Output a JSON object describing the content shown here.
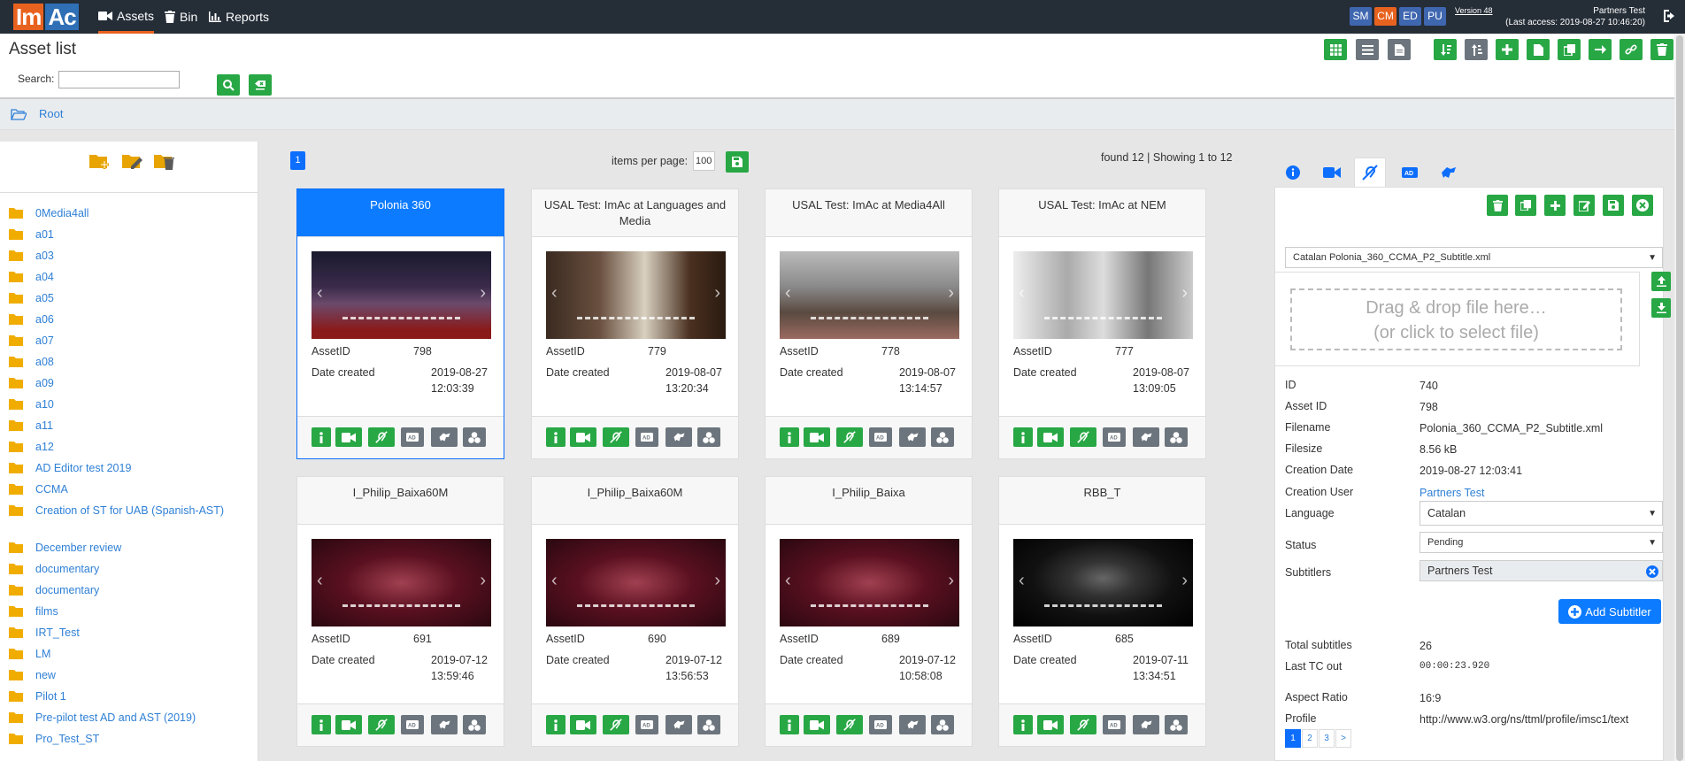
{
  "nav": {
    "logo_a": "Im",
    "logo_b": "Ac",
    "links": [
      "Assets",
      "Bin",
      "Reports"
    ],
    "roles": [
      "SM",
      "CM",
      "ED",
      "PU"
    ],
    "version": "Version 48",
    "user_name": "Partners Test",
    "last_access": "(Last access: 2019-08-27 10:46:20)",
    "accent": "#e8621f",
    "brand_blue": "#2f6fb5"
  },
  "header": {
    "title": "Asset list",
    "search_label": "Search:",
    "search_value": "",
    "toolbar_icons": [
      "grid-icon",
      "list-icon",
      "document-icon",
      "sort-down-icon",
      "sort-up-icon",
      "plus-icon",
      "file-icon",
      "copy-icon",
      "arrow-right-icon",
      "link-icon",
      "trash-icon"
    ]
  },
  "breadcrumb": {
    "root": "Root"
  },
  "sidebar": {
    "folders": [
      "0Media4all",
      "a01",
      "a03",
      "a04",
      "a05",
      "a06",
      "a07",
      "a08",
      "a09",
      "a10",
      "a11",
      "a12",
      "AD Editor test 2019",
      "CCMA",
      "Creation of ST for UAB (Spanish-AST)",
      "December review",
      "documentary",
      "documentary",
      "films",
      "IRT_Test",
      "LM",
      "new",
      "Pilot 1",
      "Pre-pilot test AD and AST (2019)",
      "Pro_Test_ST"
    ]
  },
  "listing": {
    "page": "1",
    "items_per_page_label": "items per page:",
    "items_per_page": "100",
    "found": "found 12 | Showing 1 to 12",
    "asset_id_label": "AssetID",
    "date_label": "Date created",
    "cards": [
      {
        "title": "Polonia 360",
        "asset_id": "798",
        "date": "2019-08-27",
        "time": "12:03:39",
        "selected": true,
        "theme": "dark"
      },
      {
        "title": "USAL Test: ImAc at Languages and Media",
        "asset_id": "779",
        "date": "2019-08-07",
        "time": "13:20:34",
        "selected": false,
        "theme": "room"
      },
      {
        "title": "USAL Test: ImAc at Media4All",
        "asset_id": "778",
        "date": "2019-08-07",
        "time": "13:14:57",
        "selected": false,
        "theme": "hall"
      },
      {
        "title": "USAL Test: ImAc at NEM",
        "asset_id": "777",
        "date": "2019-08-07",
        "time": "13:09:05",
        "selected": false,
        "theme": "conf"
      },
      {
        "title": "I_Philip_Baixa60M",
        "asset_id": "691",
        "date": "2019-07-12",
        "time": "13:59:46",
        "selected": false,
        "theme": "red"
      },
      {
        "title": "I_Philip_Baixa60M",
        "asset_id": "690",
        "date": "2019-07-12",
        "time": "13:56:53",
        "selected": false,
        "theme": "red"
      },
      {
        "title": "I_Philip_Baixa",
        "asset_id": "689",
        "date": "2019-07-12",
        "time": "10:58:08",
        "selected": false,
        "theme": "red"
      },
      {
        "title": "RBB_T",
        "asset_id": "685",
        "date": "2019-07-11",
        "time": "13:34:51",
        "selected": false,
        "theme": "black"
      }
    ]
  },
  "detail": {
    "file_select": "Catalan Polonia_360_CCMA_P2_Subtitle.xml",
    "drop_line1": "Drag & drop file here…",
    "drop_line2": "(or click to select file)",
    "labels": {
      "id": "ID",
      "asset_id": "Asset ID",
      "filename": "Filename",
      "filesize": "Filesize",
      "creation_date": "Creation Date",
      "creation_user": "Creation User",
      "language": "Language",
      "status": "Status",
      "subtitlers": "Subtitlers",
      "total": "Total subtitles",
      "last_tc": "Last TC out",
      "aspect": "Aspect Ratio",
      "profile": "Profile"
    },
    "values": {
      "id": "740",
      "asset_id": "798",
      "filename": "Polonia_360_CCMA_P2_Subtitle.xml",
      "filesize": "8.56 kB",
      "creation_date": "2019-08-27 12:03:41",
      "creation_user": "Partners Test",
      "language": "Catalan",
      "status": "Pending",
      "subtitlers": "Partners Test",
      "total": "26",
      "last_tc": "00:00:23.920",
      "aspect": "16:9",
      "profile": "http://www.w3.org/ns/ttml/profile/imsc1/text"
    },
    "add_subtitler": "Add Subtitler",
    "pages": [
      "1",
      "2",
      "3",
      ">"
    ]
  }
}
